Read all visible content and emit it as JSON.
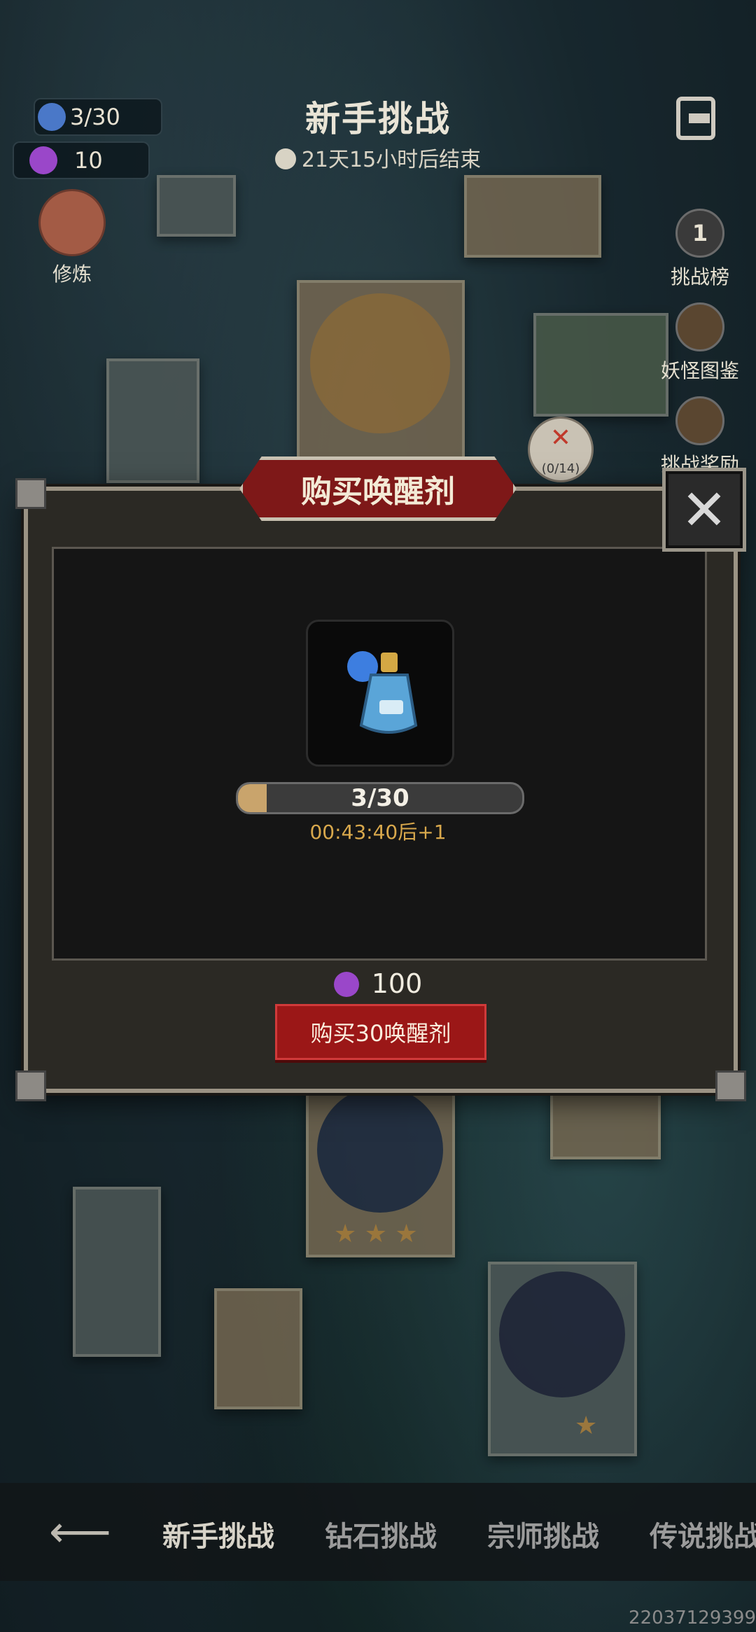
{
  "hud": {
    "awaken_count": "3/30",
    "candy_count": "10",
    "cultivate_label": "修炼"
  },
  "header": {
    "title": "新手挑战",
    "timer": "21天15小时后结束"
  },
  "side_menu": [
    {
      "label": "挑战榜",
      "icon": "rank-icon",
      "badge": "1"
    },
    {
      "label": "妖怪图鉴",
      "icon": "book-icon"
    },
    {
      "label": "挑战奖励",
      "icon": "gift-icon"
    }
  ],
  "map_badge": {
    "text": "(0/14)"
  },
  "modal": {
    "title": "购买唤醒剂",
    "progress_text": "3/30",
    "progress_fraction": 0.1,
    "refill_text": "00:43:40后+1",
    "cost": "100",
    "buy_label": "购买30唤醒剂"
  },
  "nav": {
    "tabs": [
      "新手挑战",
      "钻石挑战",
      "宗师挑战",
      "传说挑战"
    ],
    "active": 0
  },
  "watermark": "22037129399",
  "colors": {
    "accent_red": "#9b1717",
    "progress_fill": "#c9a46c",
    "timer_gold": "#d8a84c"
  }
}
